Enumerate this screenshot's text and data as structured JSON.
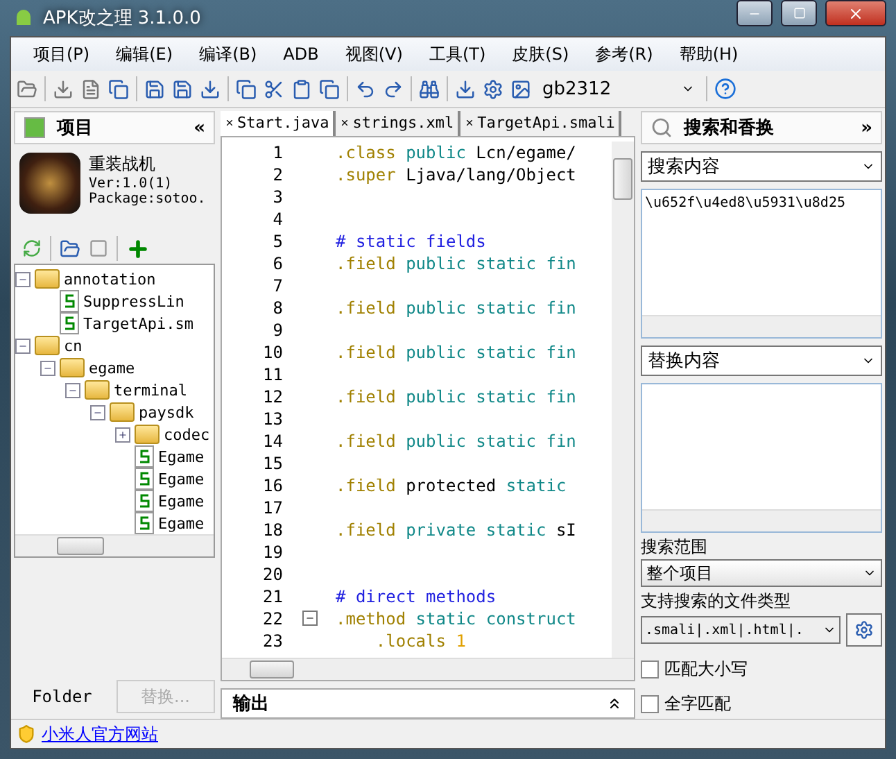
{
  "window": {
    "title": "APK改之理 3.1.0.0"
  },
  "menu": [
    "项目(P)",
    "编辑(E)",
    "编译(B)",
    "ADB",
    "视图(V)",
    "工具(T)",
    "皮肤(S)",
    "参考(R)",
    "帮助(H)"
  ],
  "toolbar": {
    "encoding": "gb2312"
  },
  "project_panel": {
    "title": "项目",
    "collapse": "«",
    "app": {
      "name": "重装战机",
      "version": "Ver:1.0(1)",
      "package": "Package:sotoo."
    },
    "tree": [
      {
        "label": "annotation",
        "kind": "folder",
        "expanded": true,
        "children": [
          {
            "label": "SuppressLin",
            "kind": "file"
          },
          {
            "label": "TargetApi.sm",
            "kind": "file"
          }
        ]
      },
      {
        "label": "cn",
        "kind": "folder",
        "expanded": true,
        "children": [
          {
            "label": "egame",
            "kind": "folder",
            "expanded": true,
            "children": [
              {
                "label": "terminal",
                "kind": "folder",
                "expanded": true,
                "children": [
                  {
                    "label": "paysdk",
                    "kind": "folder",
                    "expanded": true,
                    "children": [
                      {
                        "label": "codec",
                        "kind": "folder",
                        "expanded": false
                      },
                      {
                        "label": "Egame",
                        "kind": "file"
                      },
                      {
                        "label": "Egame",
                        "kind": "file"
                      },
                      {
                        "label": "Egame",
                        "kind": "file"
                      },
                      {
                        "label": "Egame",
                        "kind": "file"
                      }
                    ]
                  }
                ]
              }
            ]
          }
        ]
      }
    ],
    "bottom_tabs": [
      {
        "label": "Folder",
        "selected": true
      },
      {
        "label": "替换...",
        "selected": false
      }
    ]
  },
  "editor": {
    "tabs": [
      {
        "label": "Start.java",
        "selected": true
      },
      {
        "label": "strings.xml",
        "selected": false
      },
      {
        "label": "TargetApi.smali",
        "selected": false
      }
    ],
    "lines": [
      {
        "number": "1",
        "fold": false,
        "segments": [
          {
            "kind": "directive",
            "text": ".class"
          },
          {
            "kind": "keyword",
            "text": " public"
          },
          {
            "kind": "plain",
            "text": " Lcn/egame/"
          }
        ]
      },
      {
        "number": "2",
        "fold": false,
        "segments": [
          {
            "kind": "directive",
            "text": ".super"
          },
          {
            "kind": "plain",
            "text": " Ljava/lang/Object"
          }
        ]
      },
      {
        "number": "3",
        "fold": false
      },
      {
        "number": "4",
        "fold": false
      },
      {
        "number": "5",
        "fold": false,
        "segments": [
          {
            "kind": "comment",
            "text": "# static fields"
          }
        ]
      },
      {
        "number": "6",
        "fold": false,
        "segments": [
          {
            "kind": "directive",
            "text": ".field"
          },
          {
            "kind": "keyword",
            "text": " public static fin"
          }
        ]
      },
      {
        "number": "7",
        "fold": false
      },
      {
        "number": "8",
        "fold": false,
        "segments": [
          {
            "kind": "directive",
            "text": ".field"
          },
          {
            "kind": "keyword",
            "text": " public static fin"
          }
        ]
      },
      {
        "number": "9",
        "fold": false
      },
      {
        "number": "10",
        "fold": false,
        "segments": [
          {
            "kind": "directive",
            "text": ".field"
          },
          {
            "kind": "keyword",
            "text": " public static fin"
          }
        ]
      },
      {
        "number": "11",
        "fold": false
      },
      {
        "number": "12",
        "fold": false,
        "segments": [
          {
            "kind": "directive",
            "text": ".field"
          },
          {
            "kind": "keyword",
            "text": " public static fin"
          }
        ]
      },
      {
        "number": "13",
        "fold": false
      },
      {
        "number": "14",
        "fold": false,
        "segments": [
          {
            "kind": "directive",
            "text": ".field"
          },
          {
            "kind": "keyword",
            "text": " public static fin"
          }
        ]
      },
      {
        "number": "15",
        "fold": false
      },
      {
        "number": "16",
        "fold": false,
        "segments": [
          {
            "kind": "directive",
            "text": ".field"
          },
          {
            "kind": "plain",
            "text": " protected"
          },
          {
            "kind": "keyword",
            "text": " static"
          }
        ]
      },
      {
        "number": "17",
        "fold": false
      },
      {
        "number": "18",
        "fold": false,
        "segments": [
          {
            "kind": "directive",
            "text": ".field"
          },
          {
            "kind": "keyword",
            "text": " private static"
          },
          {
            "kind": "plain",
            "text": " sI"
          }
        ]
      },
      {
        "number": "19",
        "fold": false
      },
      {
        "number": "20",
        "fold": false
      },
      {
        "number": "21",
        "fold": false,
        "segments": [
          {
            "kind": "comment",
            "text": "# direct methods"
          }
        ]
      },
      {
        "number": "22",
        "fold": true,
        "segments": [
          {
            "kind": "directive",
            "text": ".method"
          },
          {
            "kind": "keyword",
            "text": " static construct"
          }
        ]
      },
      {
        "number": "23",
        "fold": false,
        "segments": [
          {
            "kind": "directive",
            "text": "    .locals"
          },
          {
            "kind": "number",
            "text": " 1"
          }
        ]
      }
    ],
    "output": {
      "title": "输出"
    }
  },
  "search_panel": {
    "title": "搜索和香换",
    "expand": "»",
    "search_combo": "搜索内容",
    "search_text": "\\u652f\\u4ed8\\u5931\\u8d25",
    "replace_combo": "替换内容",
    "scope_label": "搜索范围",
    "scope": "整个项目",
    "types_label": "支持搜索的文件类型",
    "types": ".smali|.xml|.html|.",
    "options": [
      {
        "label": "匹配大小写",
        "checked": false
      },
      {
        "label": "全字匹配",
        "checked": false
      }
    ]
  },
  "status_bar": {
    "link": "小米人官方网站"
  }
}
